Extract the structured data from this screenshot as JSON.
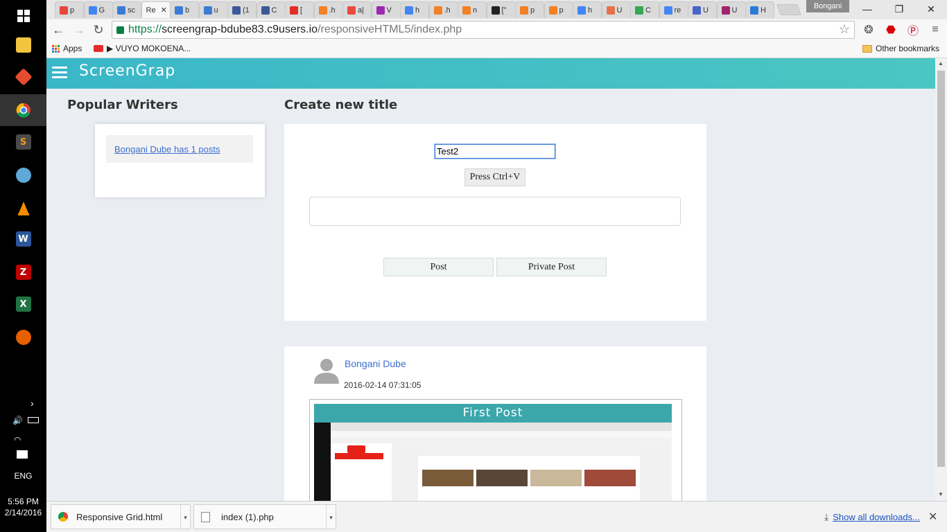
{
  "taskbar": {
    "icons": [
      "file-explorer-icon",
      "git-icon",
      "chrome-icon",
      "sublime-icon",
      "paint-icon",
      "vlc-icon",
      "word-icon",
      "filezilla-icon",
      "excel-icon",
      "firefox-icon"
    ],
    "language": "ENG",
    "time": "5:56 PM",
    "date": "2/14/2016"
  },
  "browser": {
    "tabs": [
      {
        "label": "p",
        "color": "#e8453c"
      },
      {
        "label": "G",
        "color": "#4285f4"
      },
      {
        "label": "sc",
        "color": "#3b7bd4"
      },
      {
        "label": "Re",
        "color": "#ffffff",
        "active": true
      },
      {
        "label": "b",
        "color": "#3b7bd4"
      },
      {
        "label": "u",
        "color": "#3b7bd4"
      },
      {
        "label": "(1",
        "color": "#3b5998"
      },
      {
        "label": "C",
        "color": "#3b5998"
      },
      {
        "label": "[",
        "color": "#e52d27"
      },
      {
        "label": ".h",
        "color": "#f48024"
      },
      {
        "label": "a|",
        "color": "#e74c3c"
      },
      {
        "label": "V",
        "color": "#9c27b0"
      },
      {
        "label": "h",
        "color": "#4285f4"
      },
      {
        "label": ".h",
        "color": "#f48024"
      },
      {
        "label": "n",
        "color": "#f48024"
      },
      {
        "label": "[\"",
        "color": "#222222"
      },
      {
        "label": "p",
        "color": "#f48024"
      },
      {
        "label": "p",
        "color": "#f48024"
      },
      {
        "label": "h",
        "color": "#4285f4"
      },
      {
        "label": "U",
        "color": "#e8714a"
      },
      {
        "label": "C",
        "color": "#34a853"
      },
      {
        "label": "re",
        "color": "#4285f4"
      },
      {
        "label": "U",
        "color": "#4a63c8"
      },
      {
        "label": "U",
        "color": "#a0246a"
      },
      {
        "label": "H",
        "color": "#2a7ad8"
      }
    ],
    "profile": "Bongani",
    "url_secure": "https://",
    "url_host": "screengrap-bdube83.c9users.io",
    "url_path": "/responsiveHTML5/index.php",
    "bookmarks": {
      "apps": "Apps",
      "vuyo": "▶ VUYO MOKOENA...",
      "other": "Other bookmarks"
    }
  },
  "site": {
    "title": "ScreenGrap",
    "popular_heading": "Popular Writers",
    "writer_link": "Bongani Dube has 1 posts",
    "create_heading": "Create new title",
    "title_value": "Test2",
    "paste_button": "Press Ctrl+V",
    "post_button": "Post",
    "private_post_button": "Private Post"
  },
  "post": {
    "author": "Bongani Dube",
    "date": "2016-02-14 07:31:05",
    "image_title": "First  Post"
  },
  "downloads": {
    "items": [
      "Responsive Grid.html",
      "index (1).php"
    ],
    "show_all": "Show all downloads..."
  },
  "colors": {
    "header_gradient_start": "#3ab7c8",
    "header_gradient_end": "#4cc6c2",
    "link": "#3a6fd0",
    "page_bg": "#eaeef2"
  }
}
